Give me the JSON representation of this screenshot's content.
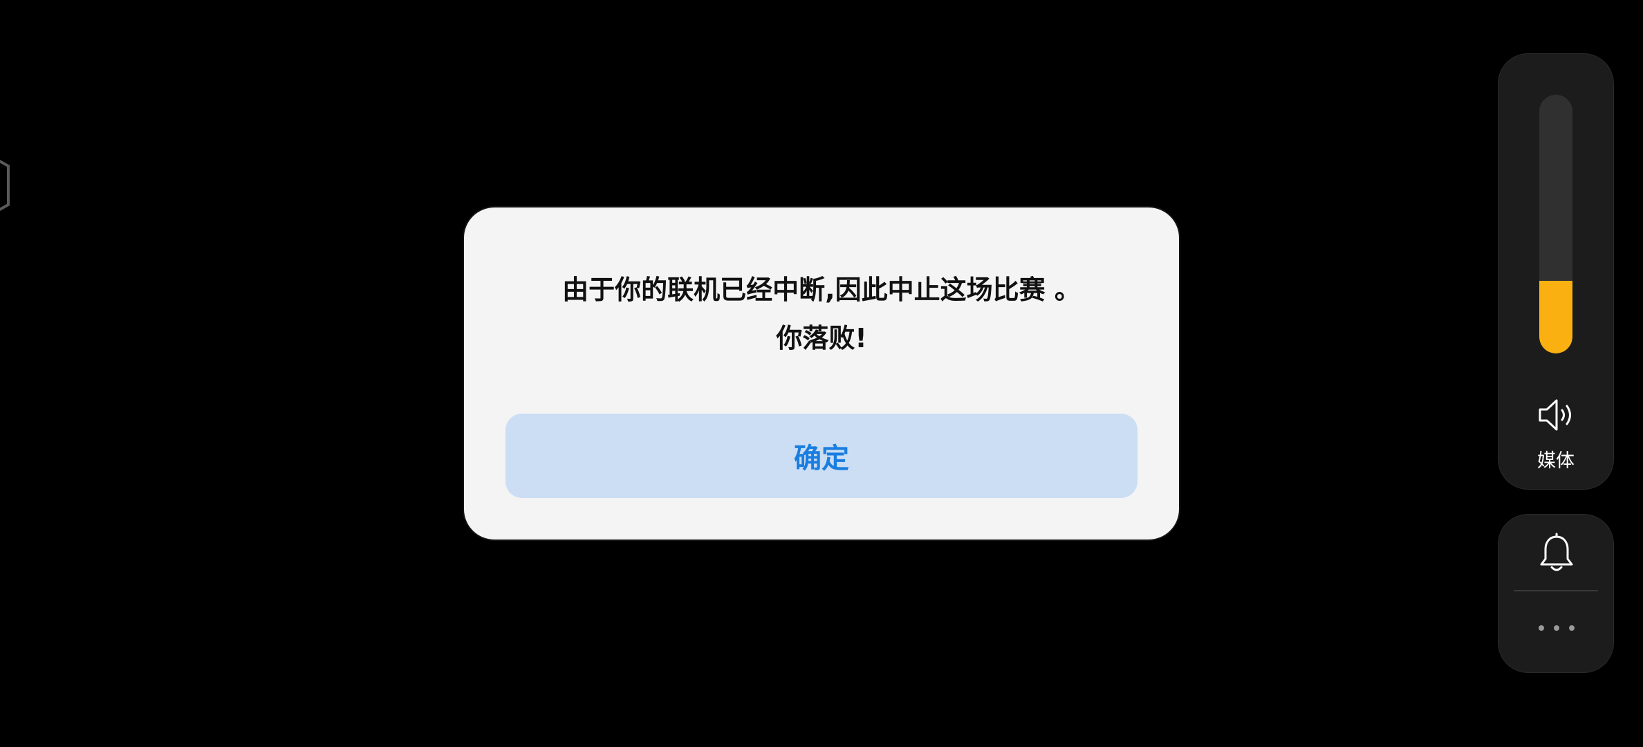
{
  "dialog": {
    "message_line1": "由于你的联机已经中断,因此中止这场比赛 。",
    "message_line2": "你落败!",
    "confirm_label": "确定"
  },
  "volume_panel": {
    "level": 0.28,
    "label": "媒体",
    "accent_color": "#fbb012",
    "icon": "speaker-icon"
  },
  "bottom_panel": {
    "icons": [
      "bell-icon",
      "more-icon"
    ]
  }
}
